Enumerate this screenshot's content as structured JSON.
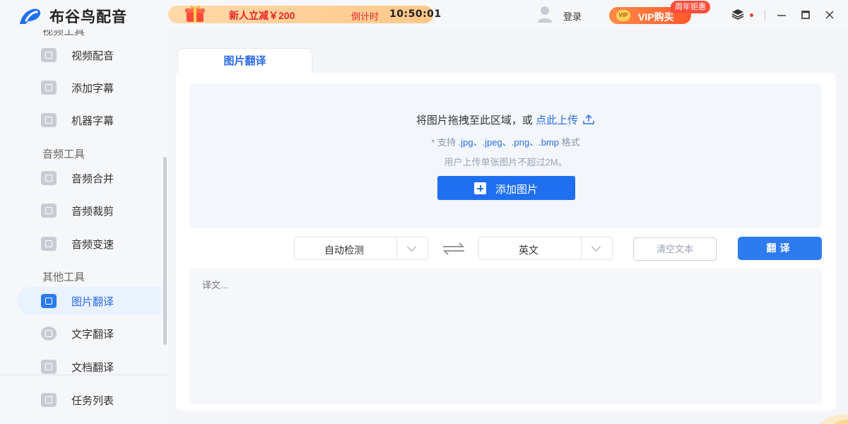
{
  "app": {
    "title": "布谷鸟配音"
  },
  "promo": {
    "text": "新人立减￥200",
    "countdown_label": "倒计时",
    "countdown": "10:50:01"
  },
  "header": {
    "login": "登录",
    "vip_label": "VIP购买",
    "vip_tag": "周年钜惠",
    "vip_badge": "VIP"
  },
  "sidebar": {
    "groups": [
      {
        "title": "视频工具"
      },
      {
        "title": "音频工具"
      },
      {
        "title": "其他工具"
      }
    ],
    "items": [
      {
        "label": "视频配音",
        "icon": "video-dub-icon"
      },
      {
        "label": "添加字幕",
        "icon": "subtitle-icon"
      },
      {
        "label": "机器字幕",
        "icon": "robot-icon"
      },
      {
        "label": "音频合并",
        "icon": "audio-merge-icon"
      },
      {
        "label": "音频裁剪",
        "icon": "scissors-icon"
      },
      {
        "label": "音频变速",
        "icon": "speed-icon"
      },
      {
        "label": "图片翻译",
        "icon": "image-translate-icon",
        "active": true
      },
      {
        "label": "文字翻译",
        "icon": "text-translate-icon"
      },
      {
        "label": "文档翻译",
        "icon": "doc-translate-icon"
      },
      {
        "label": "任务列表",
        "icon": "task-list-icon"
      }
    ]
  },
  "main": {
    "tab": "图片翻译",
    "dropzone": {
      "main_text": "将图片拖拽至此区域，或",
      "link_text": "点此上传",
      "support_prefix": "* 支持",
      "formats": ".jpg、.jpeg、.png、.bmp",
      "support_suffix": "格式",
      "limit_text": "用户上传单张图片不超过2M。",
      "add_button": "添加图片"
    },
    "source_lang": "自动检测",
    "target_lang": "英文",
    "clear_button": "清空文本",
    "translate_button": "翻译",
    "output_placeholder": "译文..."
  },
  "colors": {
    "accent": "#2b6de8",
    "primary_button": "#1f6ff0",
    "promo_text": "#e8262b",
    "vip": "#ff5a2a"
  }
}
